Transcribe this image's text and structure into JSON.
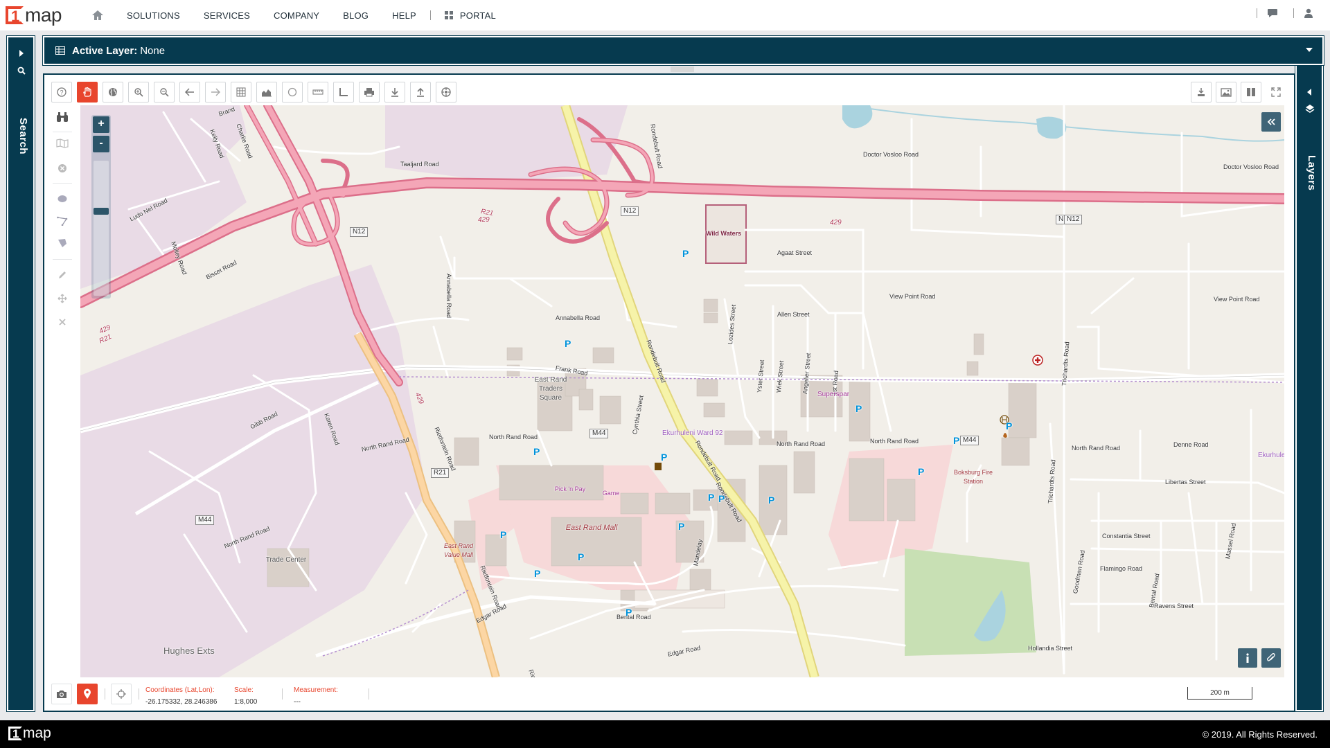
{
  "brand": {
    "logo_mark": "1",
    "logo_text": "map",
    "accent": "#e8452d",
    "primary": "#063a4f"
  },
  "nav": {
    "home_icon": "home-icon",
    "items": [
      "SOLUTIONS",
      "SERVICES",
      "COMPANY",
      "BLOG",
      "HELP"
    ],
    "portal": "PORTAL",
    "right_icons": [
      "chat-icon",
      "user-icon"
    ]
  },
  "search_panel": {
    "label": "Search"
  },
  "layers_panel": {
    "label": "Layers"
  },
  "active_layer": {
    "label": "Active Layer:",
    "value": "None"
  },
  "toolbar": {
    "top": [
      "help-icon",
      "pan-hand-icon",
      "globe-icon",
      "zoom-in-icon",
      "zoom-out-icon",
      "back-arrow-icon",
      "forward-arrow-icon",
      "grid-icon",
      "chart-icon",
      "circle-icon",
      "ruler-icon",
      "angle-icon",
      "print-icon",
      "download-icon",
      "upload-icon",
      "settings-ball-icon"
    ],
    "top_right": [
      "export-icon",
      "image-export-icon",
      "split-view-icon",
      "fullscreen-icon"
    ],
    "left": [
      "binoculars-icon",
      "map-icon",
      "clear-icon",
      "circle-draw-icon",
      "polyline-icon",
      "polygon-icon",
      "edit-icon",
      "move-icon",
      "delete-icon"
    ]
  },
  "zoom": {
    "in": "+",
    "out": "-",
    "level": 0.37
  },
  "map_labels": {
    "roads": [
      "Taaljard Road",
      "Doctor Vosloo Road",
      "Doctor Vosloo Road",
      "Kelly Road",
      "Charlie Road",
      "Brand",
      "Ludo Nel Road",
      "Molley Road",
      "Bisset Road",
      "Annabella Road",
      "Annabella Road",
      "Frank Road",
      "Agaat Street",
      "View Point Road",
      "View Point Road",
      "Allen Street",
      "Lozides Street",
      "Yster Street",
      "Wiek Street",
      "Angelier Street",
      "1st Road",
      "Trichardts Road",
      "Trichardts Road",
      "Cynthia Street",
      "Rondebult Road",
      "Rondebult Road",
      "Rondebult Road",
      "Rondebult Road",
      "Rietfontein Road",
      "Rietfontein Road",
      "Rietfontein Road",
      "North Rand Road",
      "North Rand Road",
      "North Rand Road",
      "North Rand Road",
      "North Rand Road",
      "North Rand Road",
      "Denne Road",
      "Gibb Road",
      "Karen Road",
      "Libertas Street",
      "Constantia Street",
      "Flamingo Road",
      "Goodman Road",
      "Massel Road",
      "Ravens Street",
      "Bental Road",
      "Bental Road",
      "Mandelay",
      "Edgar Road",
      "Edgar Road",
      "Hollandia Street"
    ],
    "shields": [
      "N12",
      "N12",
      "N12",
      "N12",
      "M44",
      "M44",
      "M44",
      "R21"
    ],
    "route_numbers": [
      "R21",
      "429",
      "429",
      "R21",
      "429",
      "429"
    ],
    "places": [
      "Wild Waters",
      "East Rand Traders Square",
      "Pick 'n Pay",
      "Game",
      "East Rand Mall",
      "East Rand Value Mall",
      "Superspar",
      "Boksburg Fire Station",
      "Trade Center",
      "Hughes Exts",
      "Ekurhuleni Ward 92",
      "Ekurhule"
    ],
    "parking": "P"
  },
  "status": {
    "coords_label": "Coordinates (Lat,Lon):",
    "coords_value": "-26.175332, 28.246386",
    "scale_label": "Scale:",
    "scale_value": "1:8,000",
    "measure_label": "Measurement:",
    "measure_value": "---",
    "scalebar": "200 m"
  },
  "footer": {
    "copyright": "© 2019. All Rights Reserved."
  }
}
